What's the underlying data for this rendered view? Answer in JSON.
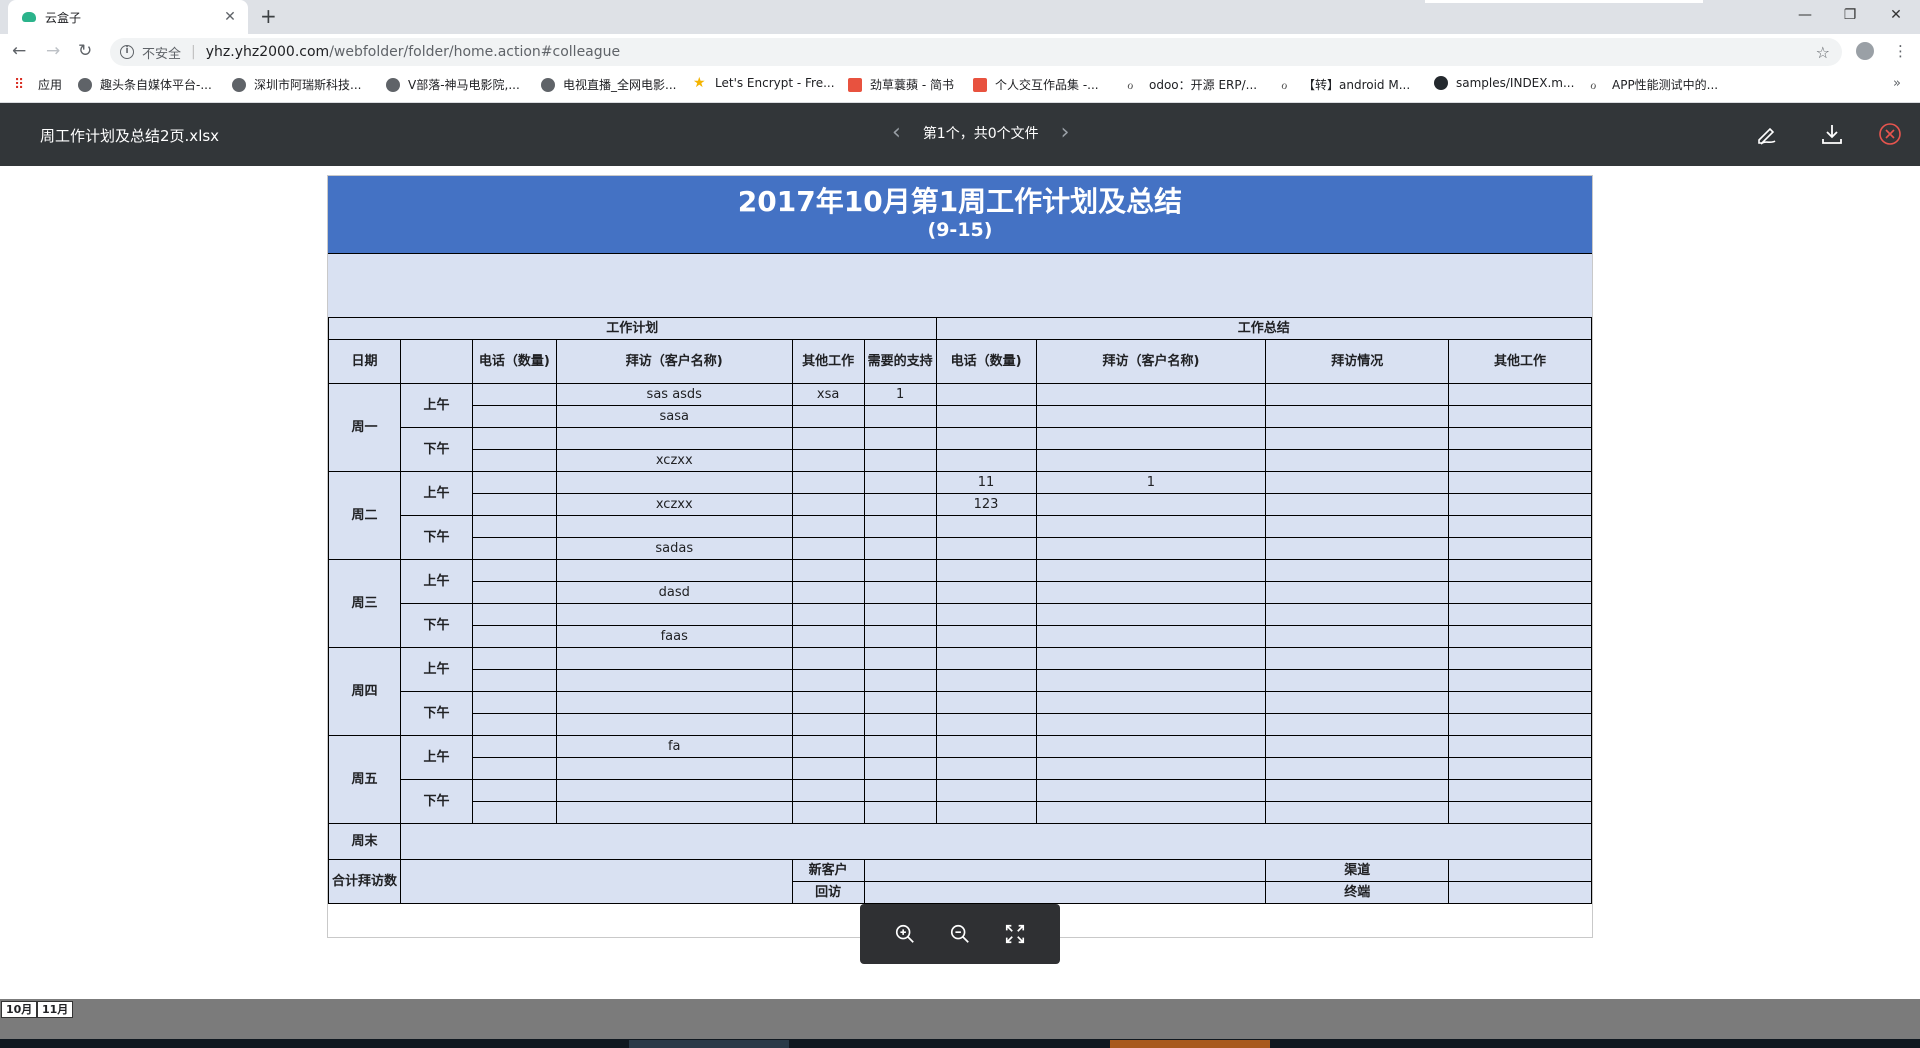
{
  "browser": {
    "tab_title": "云盒子",
    "tab_close": "✕",
    "new_tab": "+",
    "security_label": "不安全",
    "url_host": "yhz.yhz2000.com",
    "url_path": "/webfolder/folder/home.action#colleague",
    "bookmarks": [
      {
        "label": "应用",
        "icon": "apps-icon"
      },
      {
        "label": "趣头条自媒体平台-...",
        "icon": "globe-icon"
      },
      {
        "label": "深圳市阿瑞斯科技...",
        "icon": "globe-icon"
      },
      {
        "label": "V部落-神马电影院,...",
        "icon": "globe-icon"
      },
      {
        "label": "电视直播_全网电影...",
        "icon": "globe-icon"
      },
      {
        "label": "Let's Encrypt - Fre...",
        "icon": "letsencrypt-icon"
      },
      {
        "label": "劲草蘘蘋 - 简书",
        "icon": "jianshu-icon"
      },
      {
        "label": "个人交互作品集 -...",
        "icon": "jianshu-icon"
      },
      {
        "label": "odoo：开源 ERP/...",
        "icon": "odoo-icon"
      },
      {
        "label": "【转】android M...",
        "icon": "odoo-icon"
      },
      {
        "label": "samples/INDEX.m...",
        "icon": "github-icon"
      },
      {
        "label": "APP性能测试中的...",
        "icon": "odoo-icon"
      }
    ]
  },
  "viewer": {
    "file_name": "周工作计划及总结2页.xlsx",
    "pager_text": "第1个，共0个文件"
  },
  "sheet": {
    "title": "2017年10月第1周工作计划及总结",
    "subtitle": "(9-15)",
    "plan_header": "工作计划",
    "summary_header": "工作总结",
    "col_date": "日期",
    "col_phone": "电话（数量)",
    "col_visit": "拜访（客户名称)",
    "col_other": "其他工作",
    "col_support": "需要的支持",
    "col_phone2": "电话（数量)",
    "col_visit2": "拜访（客户名称)",
    "col_visit_status": "拜访情况",
    "col_other2": "其他工作",
    "days": [
      "周一",
      "周二",
      "周三",
      "周四",
      "周五"
    ],
    "am": "上午",
    "pm": "下午",
    "weekend": "周末",
    "total_visits": "合计拜访数",
    "new_customer": "新客户",
    "revisit": "回访",
    "channel": "渠道",
    "terminal": "终端",
    "rows": [
      [
        "",
        "sas asds",
        "xsa",
        "1",
        "",
        "",
        "",
        ""
      ],
      [
        "",
        "sasa",
        "",
        "",
        "",
        "",
        "",
        ""
      ],
      [
        "",
        "",
        "",
        "",
        "",
        "",
        "",
        ""
      ],
      [
        "",
        "xczxx",
        "",
        "",
        "",
        "",
        "",
        ""
      ],
      [
        "",
        "",
        "",
        "",
        "11",
        "1",
        "",
        ""
      ],
      [
        "",
        "xczxx",
        "",
        "",
        "123",
        "",
        "",
        ""
      ],
      [
        "",
        "",
        "",
        "",
        "",
        "",
        "",
        ""
      ],
      [
        "",
        "sadas",
        "",
        "",
        "",
        "",
        "",
        ""
      ],
      [
        "",
        "",
        "",
        "",
        "",
        "",
        "",
        ""
      ],
      [
        "",
        "dasd",
        "",
        "",
        "",
        "",
        "",
        ""
      ],
      [
        "",
        "",
        "",
        "",
        "",
        "",
        "",
        ""
      ],
      [
        "",
        "faas",
        "",
        "",
        "",
        "",
        "",
        ""
      ],
      [
        "",
        "",
        "",
        "",
        "",
        "",
        "",
        ""
      ],
      [
        "",
        "",
        "",
        "",
        "",
        "",
        "",
        ""
      ],
      [
        "",
        "",
        "",
        "",
        "",
        "",
        "",
        ""
      ],
      [
        "",
        "",
        "",
        "",
        "",
        "",
        "",
        ""
      ],
      [
        "",
        "fa",
        "",
        "",
        "",
        "",
        "",
        ""
      ],
      [
        "",
        "",
        "",
        "",
        "",
        "",
        "",
        ""
      ],
      [
        "",
        "",
        "",
        "",
        "",
        "",
        "",
        ""
      ],
      [
        "",
        "",
        "",
        "",
        "",
        "",
        "",
        ""
      ]
    ]
  },
  "sheet_tabs": [
    "10月",
    "11月"
  ],
  "colors": {
    "banner": "#4472c4",
    "cell": "#d9e1f2",
    "viewer_header": "#323639",
    "close_accent": "#e8554e"
  }
}
